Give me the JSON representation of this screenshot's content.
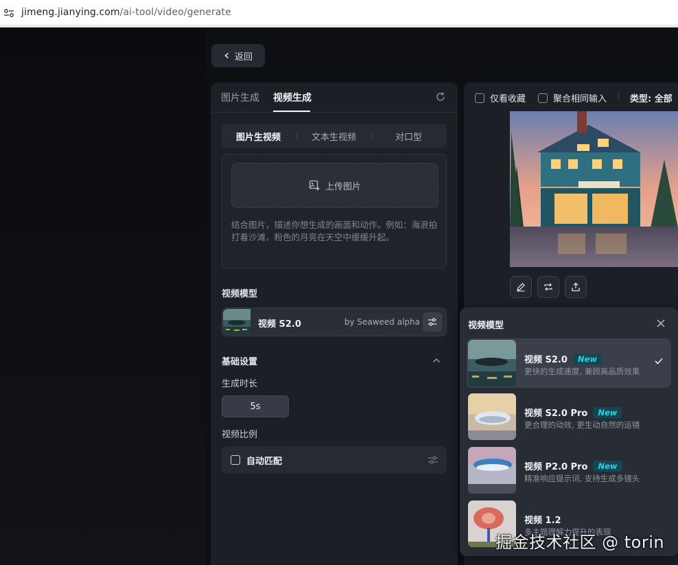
{
  "browser": {
    "url_host": "jimeng.jianying.com",
    "url_path": "/ai-tool/video/generate"
  },
  "back_label": "返回",
  "panel": {
    "tabs": [
      "图片生成",
      "视频生成"
    ],
    "active_tab": "视频生成",
    "subtabs": [
      "图片生视频",
      "文本生视频",
      "对口型"
    ],
    "active_subtab": "图片生视频",
    "upload_label": "上传图片",
    "upload_hint": "结合图片，描述你想生成的画面和动作。例如：海浪拍打着沙滩，粉色的月亮在天空中缓缓升起。",
    "model_section": "视频模型",
    "model_name": "视频 S2.0",
    "model_by": "by Seaweed alpha",
    "basic_settings": "基础设置",
    "duration_label": "生成时长",
    "duration_value": "5s",
    "ratio_label": "视频比例",
    "ratio_value": "自动匹配"
  },
  "preview": {
    "filter_favorites": "仅看收藏",
    "filter_merge": "聚合相同输入",
    "filter_type": "类型: 全部"
  },
  "model_popup": {
    "title": "视频模型",
    "items": [
      {
        "name": "视频 S2.0",
        "badge": "New",
        "desc": "更快的生成速度, 兼顾高品质效果",
        "selected": true
      },
      {
        "name": "视频 S2.0 Pro",
        "badge": "New",
        "desc": "更合理的动效, 更生动自然的运镜",
        "selected": false
      },
      {
        "name": "视频 P2.0 Pro",
        "badge": "New",
        "desc": "精准响应提示词, 支持生成多镜头",
        "selected": false
      },
      {
        "name": "视频 1.2",
        "badge": "",
        "desc": "多主题理解力提升的表现",
        "selected": false
      }
    ]
  },
  "watermark": "掘金技术社区 @ torin",
  "colors": {
    "accent_badge": "#27d6e6",
    "panel_bg": "#1c1f26"
  }
}
